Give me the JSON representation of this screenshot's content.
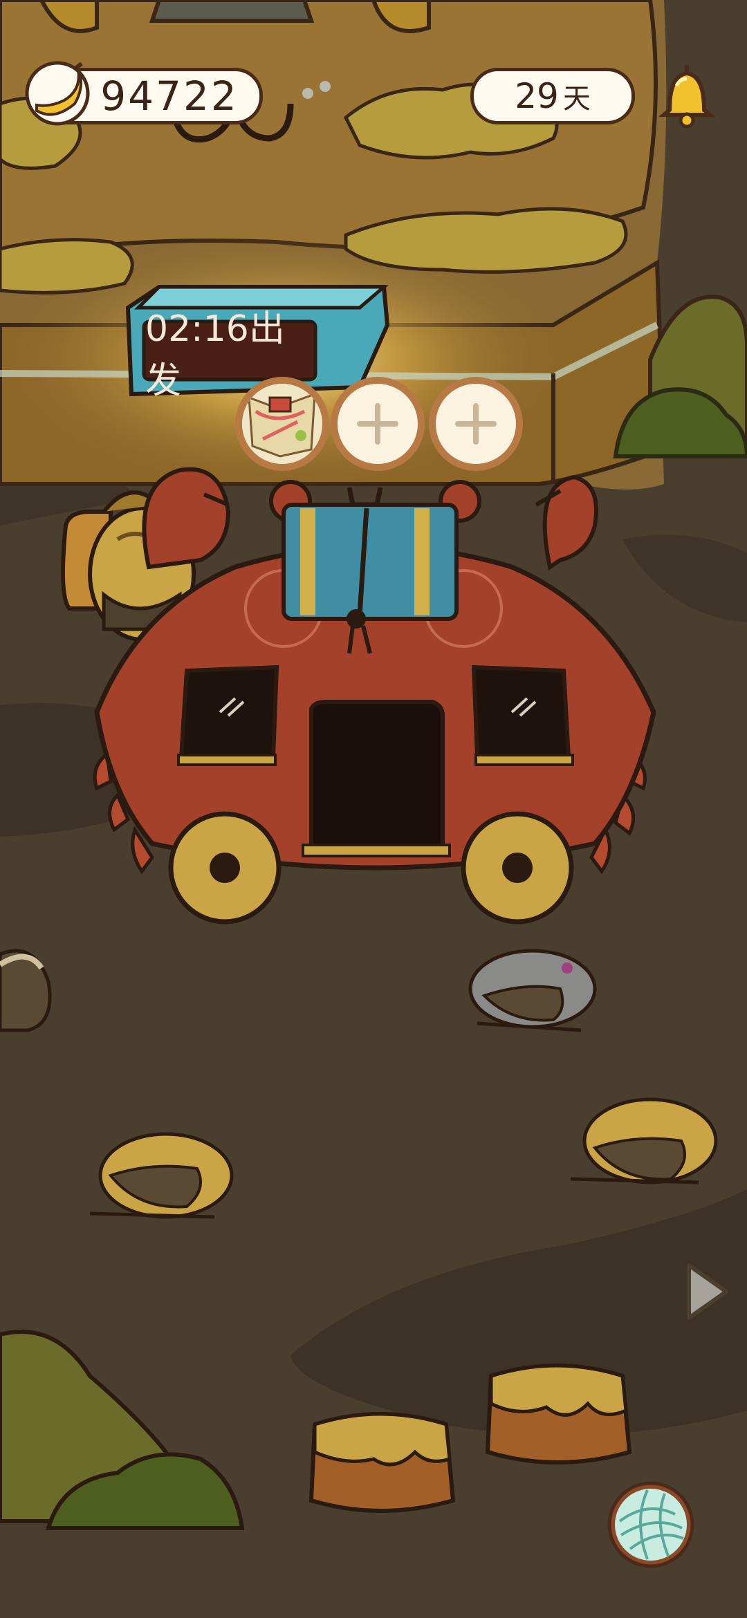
{
  "hud": {
    "banana_count": "94722",
    "days_value": "29",
    "days_unit": "天"
  },
  "departure": {
    "timer_text": "02:16出发"
  },
  "icons": {
    "banana": "banana-icon",
    "bell": "bell-icon",
    "plus": "plus-icon",
    "next": "play-arrow-icon",
    "yarn": "yarn-ball-icon"
  },
  "colors": {
    "background": "#4a3e2e",
    "timer_frame": "#4aa9b8",
    "carriage": "#a4412a",
    "bush": "#5b6a25"
  }
}
